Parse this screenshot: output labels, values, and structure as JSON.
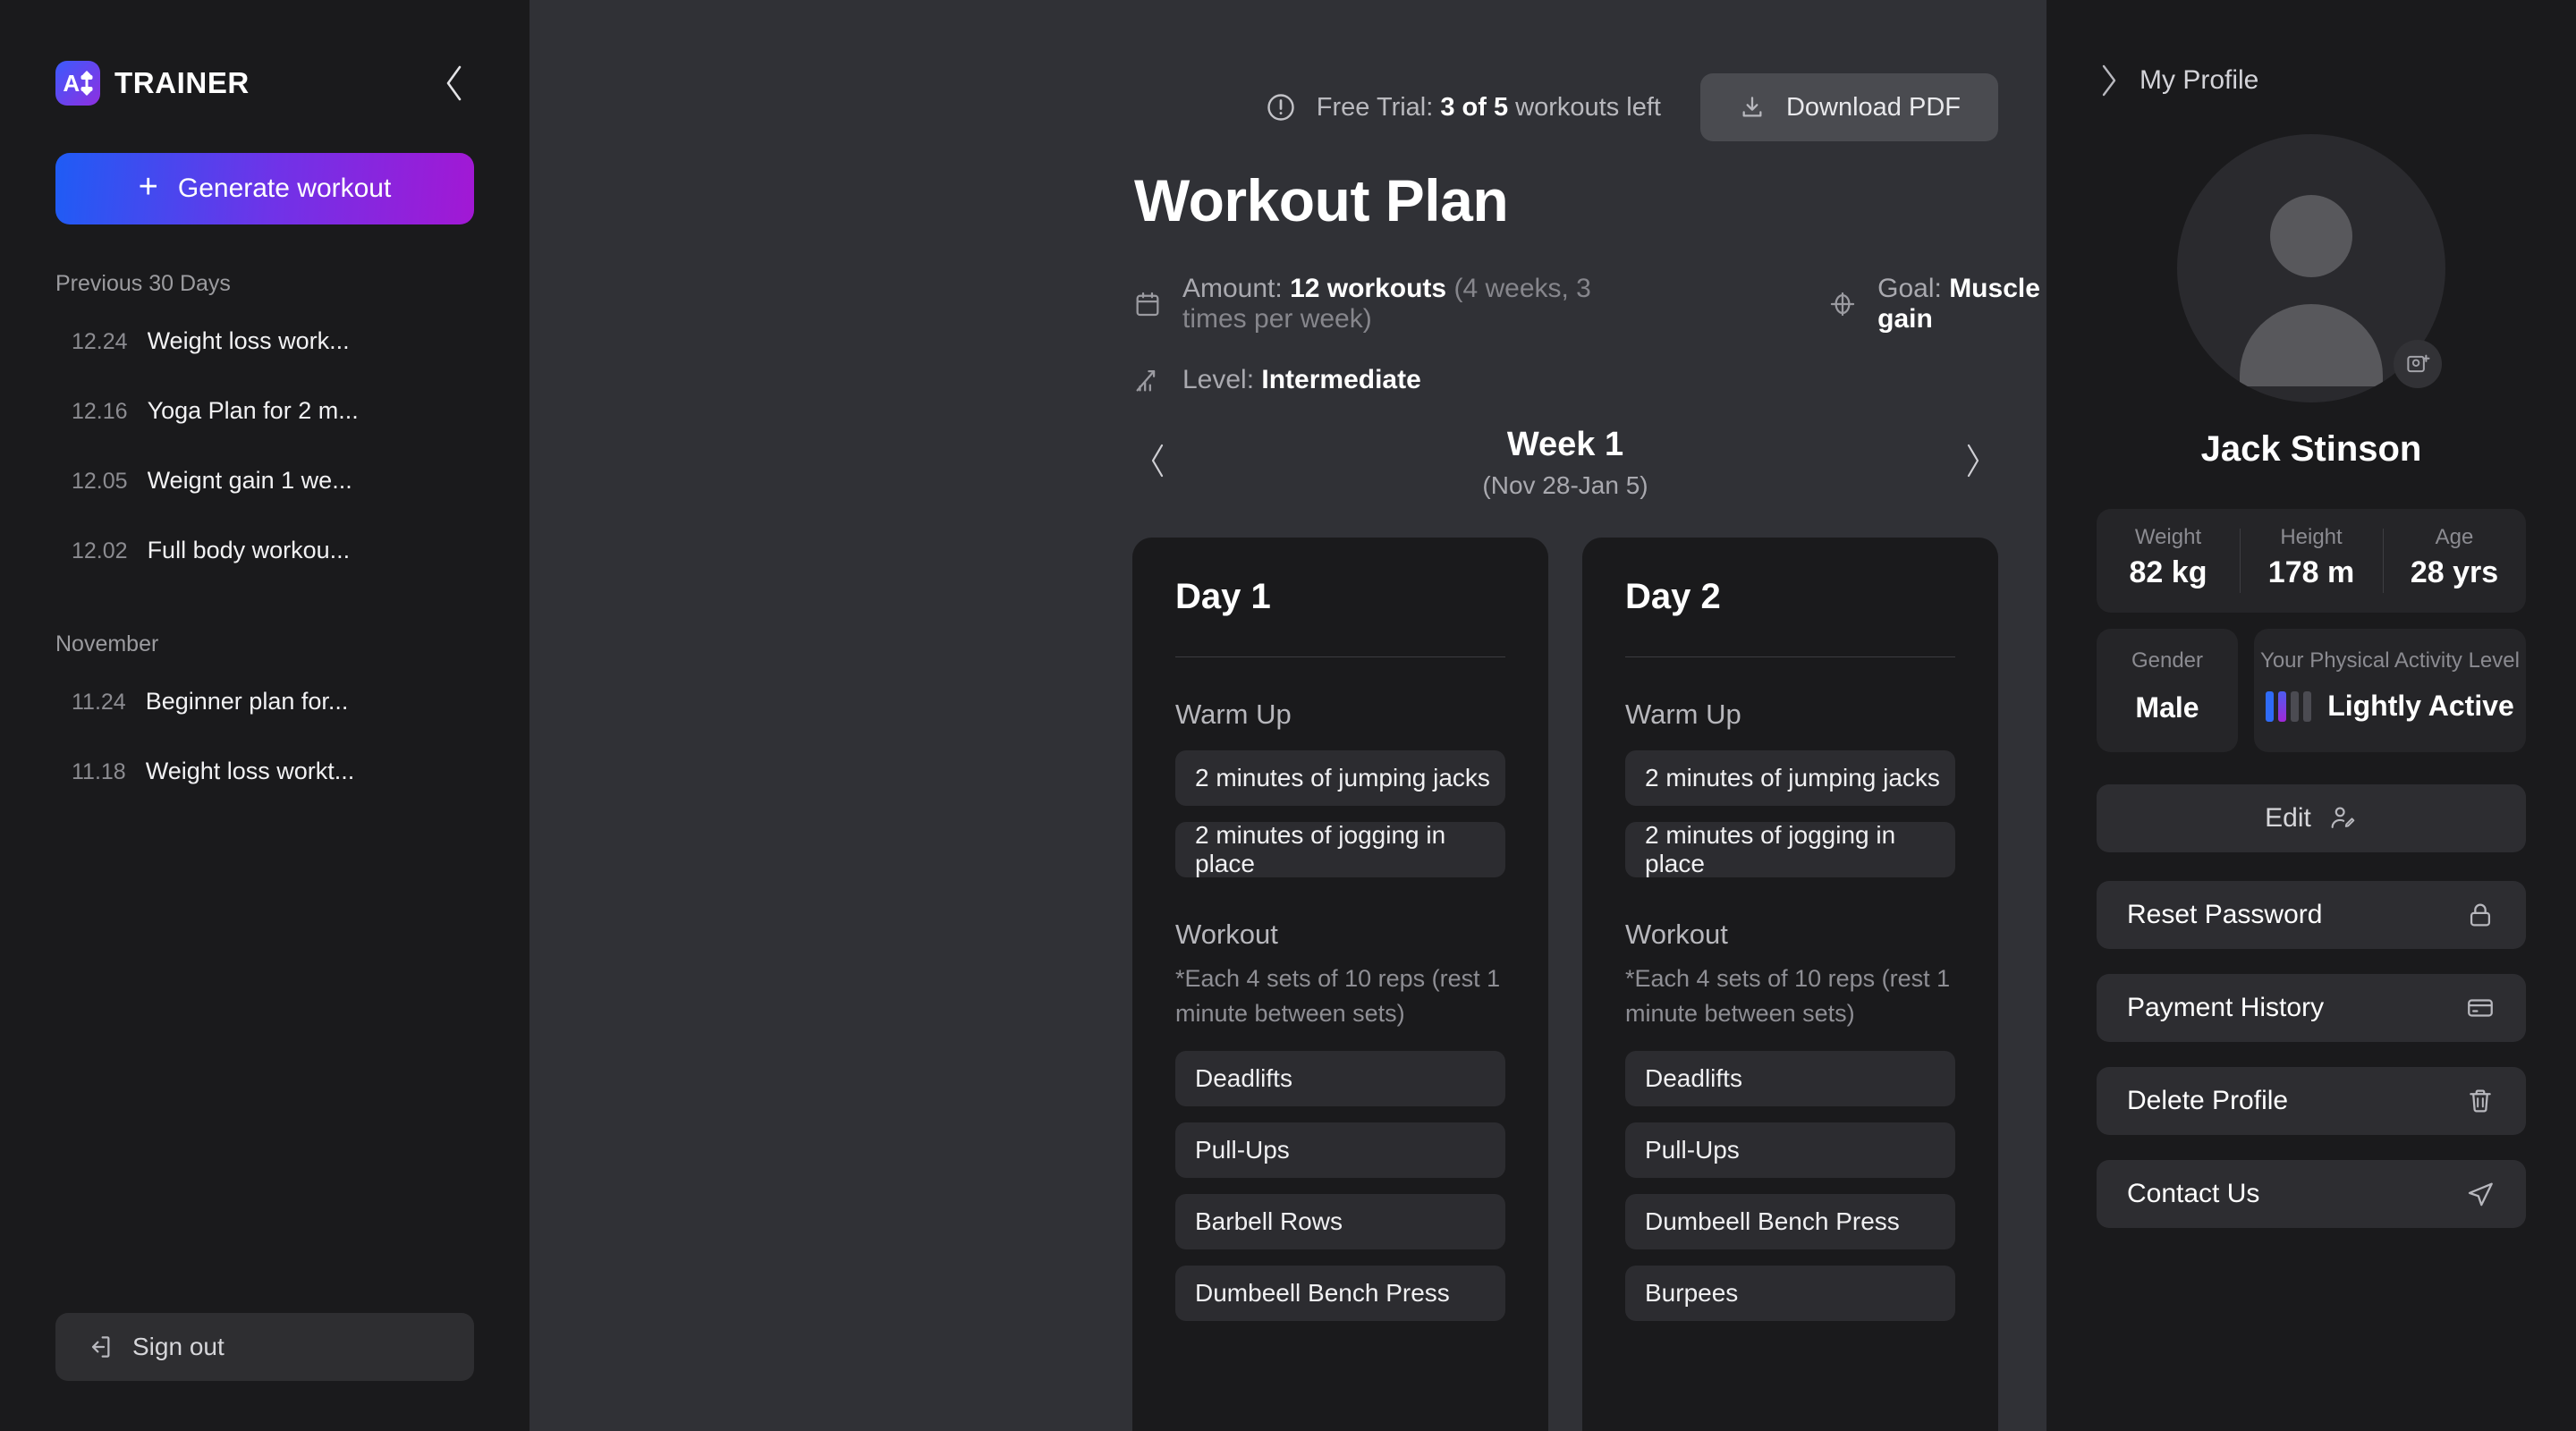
{
  "brand": {
    "name": "TRAINER",
    "logo_letter": "A",
    "collapse_icon": "chevron-left-icon"
  },
  "sidebar": {
    "generate_button": {
      "label": "Generate workout",
      "icon": "plus-icon"
    },
    "groups": [
      {
        "label": "Previous 30 Days",
        "items": [
          {
            "date": "12.24",
            "title": "Weight loss work..."
          },
          {
            "date": "12.16",
            "title": "Yoga Plan for 2 m..."
          },
          {
            "date": "12.05",
            "title": "Weignt gain 1 we..."
          },
          {
            "date": "12.02",
            "title": "Full body workou..."
          }
        ]
      },
      {
        "label": "November",
        "items": [
          {
            "date": "11.24",
            "title": "Beginner plan for..."
          },
          {
            "date": "11.18",
            "title": "Weight loss workt..."
          }
        ]
      }
    ],
    "signout": {
      "label": "Sign out",
      "icon": "sign-out-icon"
    }
  },
  "main": {
    "trial": {
      "icon": "alert-circle-icon",
      "prefix": "Free Trial: ",
      "count": "3 of 5",
      "suffix": " workouts left"
    },
    "download_button": {
      "label": "Download PDF",
      "icon": "download-icon"
    },
    "title": "Workout Plan",
    "meta": {
      "amount": {
        "icon": "calendar-icon",
        "label": "Amount: ",
        "value": "12 workouts",
        "note": " (4 weeks, 3 times per week)"
      },
      "goal": {
        "icon": "target-icon",
        "label": "Goal: ",
        "value": "Muscle gain"
      },
      "level": {
        "icon": "chart-up-icon",
        "label": "Level: ",
        "value": "Intermediate"
      }
    },
    "week": {
      "prev_icon": "chevron-left-icon",
      "next_icon": "chevron-right-icon",
      "title": "Week 1",
      "range": "(Nov 28-Jan 5)"
    },
    "days": [
      {
        "title": "Day 1",
        "warmup_label": "Warm Up",
        "warmup": [
          "2 minutes of jumping jacks",
          "2 minutes of jogging in place"
        ],
        "workout_label": "Workout",
        "workout_note": "*Each 4 sets of 10 reps (rest 1 minute between sets)",
        "exercises": [
          "Deadlifts",
          "Pull-Ups",
          "Barbell Rows",
          "Dumbeell Bench Press"
        ]
      },
      {
        "title": "Day 2",
        "warmup_label": "Warm Up",
        "warmup": [
          "2 minutes of jumping jacks",
          "2 minutes of jogging in place"
        ],
        "workout_label": "Workout",
        "workout_note": "*Each 4 sets of 10 reps (rest 1 minute between sets)",
        "exercises": [
          "Deadlifts",
          "Pull-Ups",
          "Dumbeell Bench Press",
          "Burpees"
        ]
      }
    ]
  },
  "profile": {
    "header": {
      "label": "My Profile",
      "icon": "chevron-right-icon"
    },
    "avatar": {
      "icon": "user-placeholder-icon",
      "camera_badge_icon": "add-photo-icon"
    },
    "name": "Jack Stinson",
    "stats": [
      {
        "label": "Weight",
        "value": "82 kg"
      },
      {
        "label": "Height",
        "value": "178 m"
      },
      {
        "label": "Age",
        "value": "28 yrs"
      }
    ],
    "gender": {
      "label": "Gender",
      "value": "Male"
    },
    "activity": {
      "label": "Your Physical Activity Level",
      "value": "Lightly Active",
      "level": 2,
      "total": 4
    },
    "edit_button": {
      "label": "Edit",
      "icon": "edit-user-icon"
    },
    "actions": [
      {
        "label": "Reset Password",
        "icon": "lock-icon"
      },
      {
        "label": "Payment History",
        "icon": "credit-card-icon"
      },
      {
        "label": "Delete Profile",
        "icon": "trash-icon"
      },
      {
        "label": "Contact Us",
        "icon": "send-icon"
      }
    ]
  },
  "colors": {
    "brand_gradient_start": "#1f5cf5",
    "brand_gradient_end": "#a218d4",
    "sidebar_bg": "#1a1a1c",
    "center_bg": "#303136",
    "card_bg": "#1a1a1c",
    "chip_bg": "#2c2c30"
  }
}
